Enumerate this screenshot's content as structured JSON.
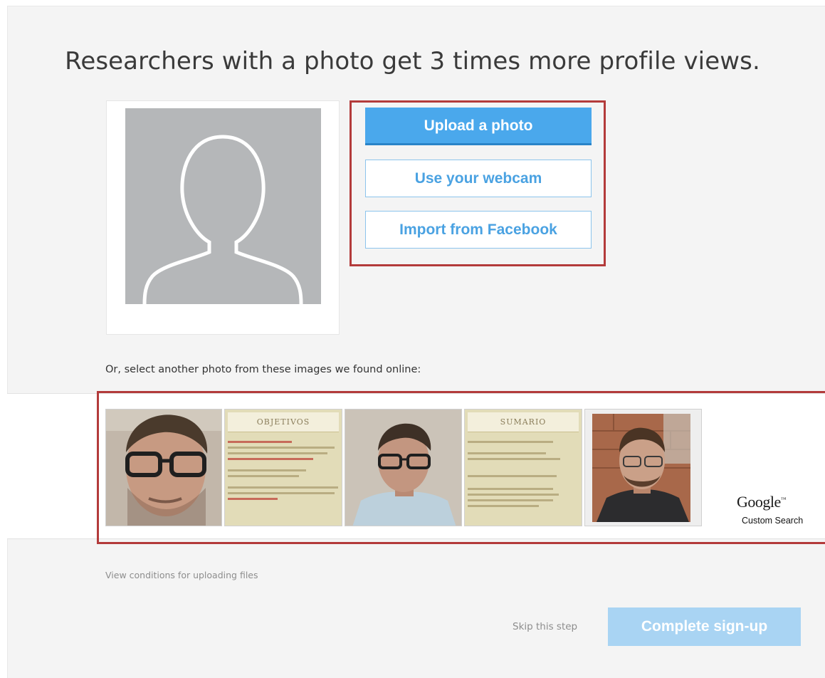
{
  "headline": "Researchers with a photo get 3 times more profile views.",
  "upload": {
    "upload_label": "Upload a photo",
    "webcam_label": "Use your webcam",
    "facebook_label": "Import from Facebook"
  },
  "found": {
    "prompt": "Or, select another photo from these images we found online:",
    "slide1_title": "OBJETIVOS",
    "slide2_title": "SUMARIO",
    "google_brand": "Google",
    "google_tm": "™",
    "google_sub": "Custom Search"
  },
  "footer": {
    "conditions": "View conditions for uploading files",
    "skip": "Skip this step",
    "complete": "Complete sign-up"
  },
  "colors": {
    "primary": "#4aa8ec",
    "highlight": "#b33b3b",
    "disabled_primary": "#a9d4f3"
  }
}
